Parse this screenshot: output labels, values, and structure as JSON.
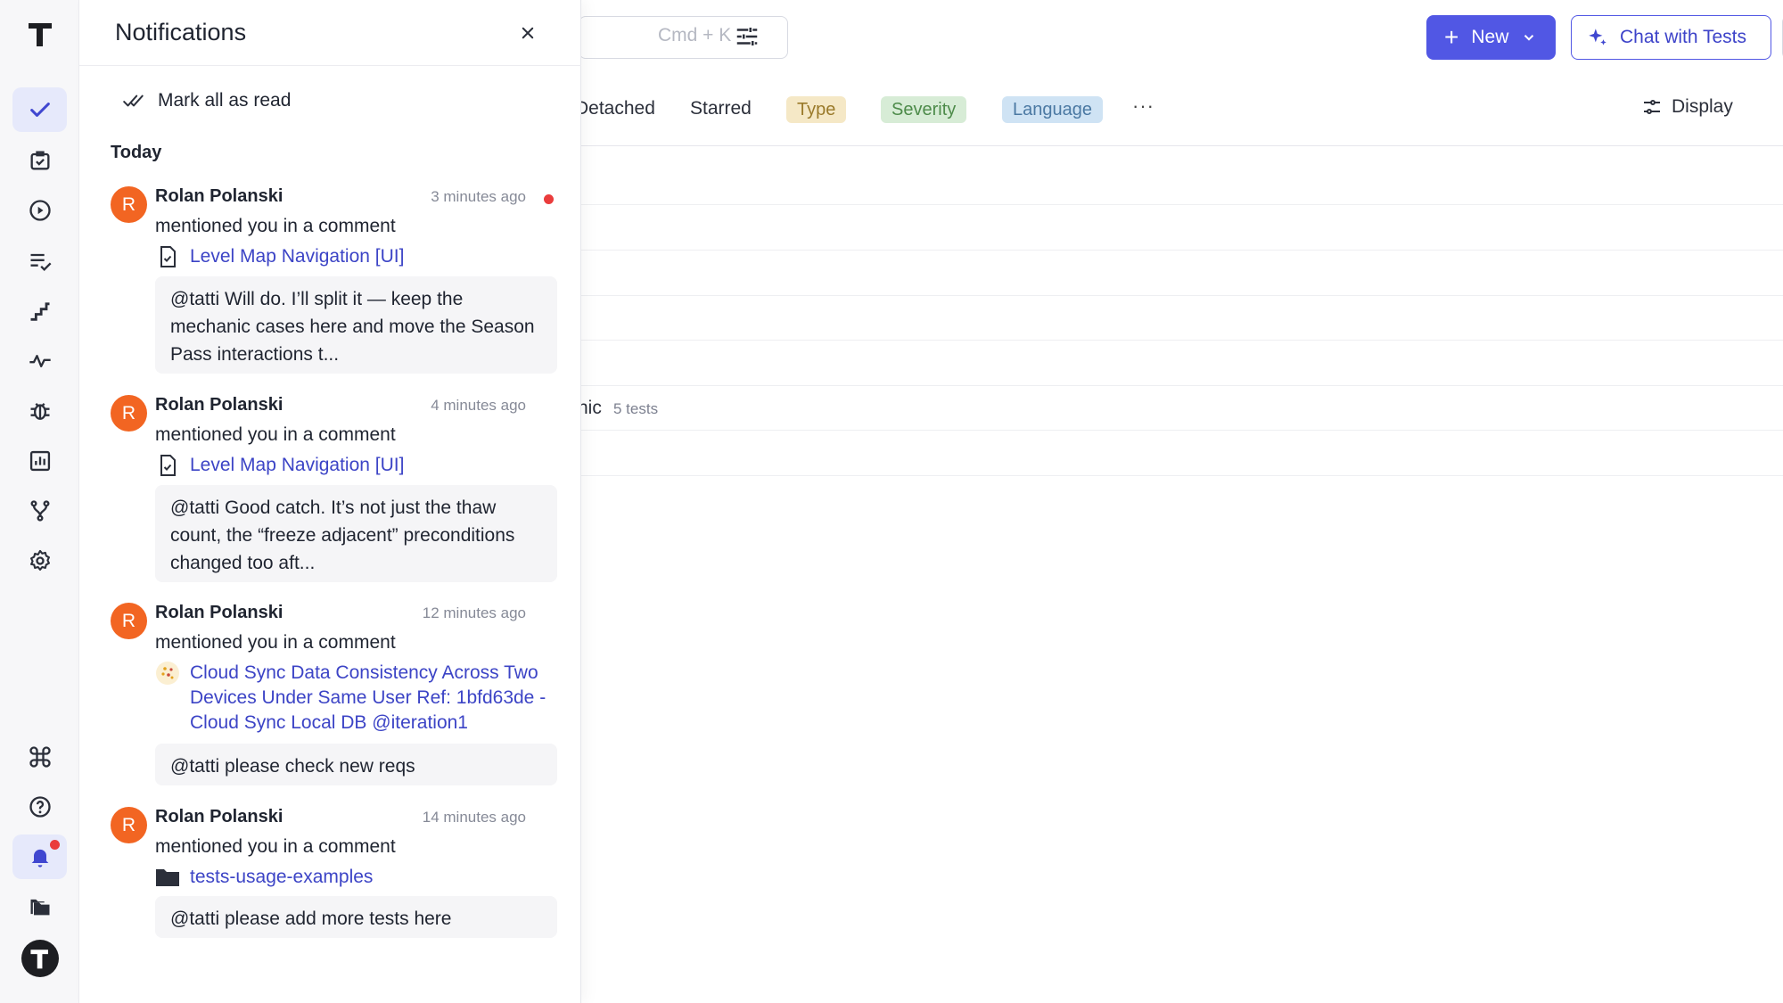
{
  "rail": {
    "logo": "T",
    "items": [
      {
        "name": "check-icon",
        "active": true
      },
      {
        "name": "clipboard-check-icon"
      },
      {
        "name": "play-circle-icon"
      },
      {
        "name": "list-check-icon"
      },
      {
        "name": "stairs-icon"
      },
      {
        "name": "pulse-icon"
      },
      {
        "name": "bug-icon"
      },
      {
        "name": "bar-chart-icon"
      },
      {
        "name": "branch-icon"
      },
      {
        "name": "gear-icon"
      },
      {
        "name": "command-icon"
      },
      {
        "name": "help-circle-icon"
      },
      {
        "name": "bell-icon",
        "active": true
      },
      {
        "name": "folders-icon"
      }
    ],
    "user_avatar_letter": "T"
  },
  "toolbar": {
    "search_hint": "Cmd + K",
    "new_label": "New",
    "chat_label": "Chat with Tests"
  },
  "tabs": {
    "detached": "Detached",
    "starred": "Starred",
    "type": "Type",
    "severity": "Severity",
    "language": "Language",
    "more": "···",
    "display": "Display"
  },
  "list": {
    "partial_row_text": "nic",
    "partial_row_count": "5 tests"
  },
  "notifications": {
    "title": "Notifications",
    "mark_all": "Mark all as read",
    "section": "Today",
    "items": [
      {
        "avatar": "R",
        "name": "Rolan Polanski",
        "time": "3 minutes ago",
        "unread": true,
        "action": "mentioned you in a comment",
        "link_icon": "file-check-icon",
        "link": "Level Map Navigation [UI]",
        "quote": "@tatti Will do. I’ll split it — keep the mechanic cases here and move the Season Pass interactions t..."
      },
      {
        "avatar": "R",
        "name": "Rolan Polanski",
        "time": "4 minutes ago",
        "unread": false,
        "action": "mentioned you in a comment",
        "link_icon": "file-check-icon",
        "link": "Level Map Navigation [UI]",
        "quote": "@tatti Good catch. It’s not just the thaw count, the “freeze adjacent” preconditions changed too aft..."
      },
      {
        "avatar": "R",
        "name": "Rolan Polanski",
        "time": "12 minutes ago",
        "unread": false,
        "action": "mentioned you in a comment",
        "link_icon": "sparkle-run-icon",
        "link": "Cloud Sync Data Consistency Across Two Devices Under Same User Ref: 1bfd63de - Cloud Sync Local DB @iteration1",
        "quote": "@tatti please check new reqs"
      },
      {
        "avatar": "R",
        "name": "Rolan Polanski",
        "time": "14 minutes ago",
        "unread": false,
        "action": "mentioned you in a comment",
        "link_icon": "folder-icon",
        "link": "tests-usage-examples",
        "quote": "@tatti please add more tests here"
      }
    ]
  }
}
